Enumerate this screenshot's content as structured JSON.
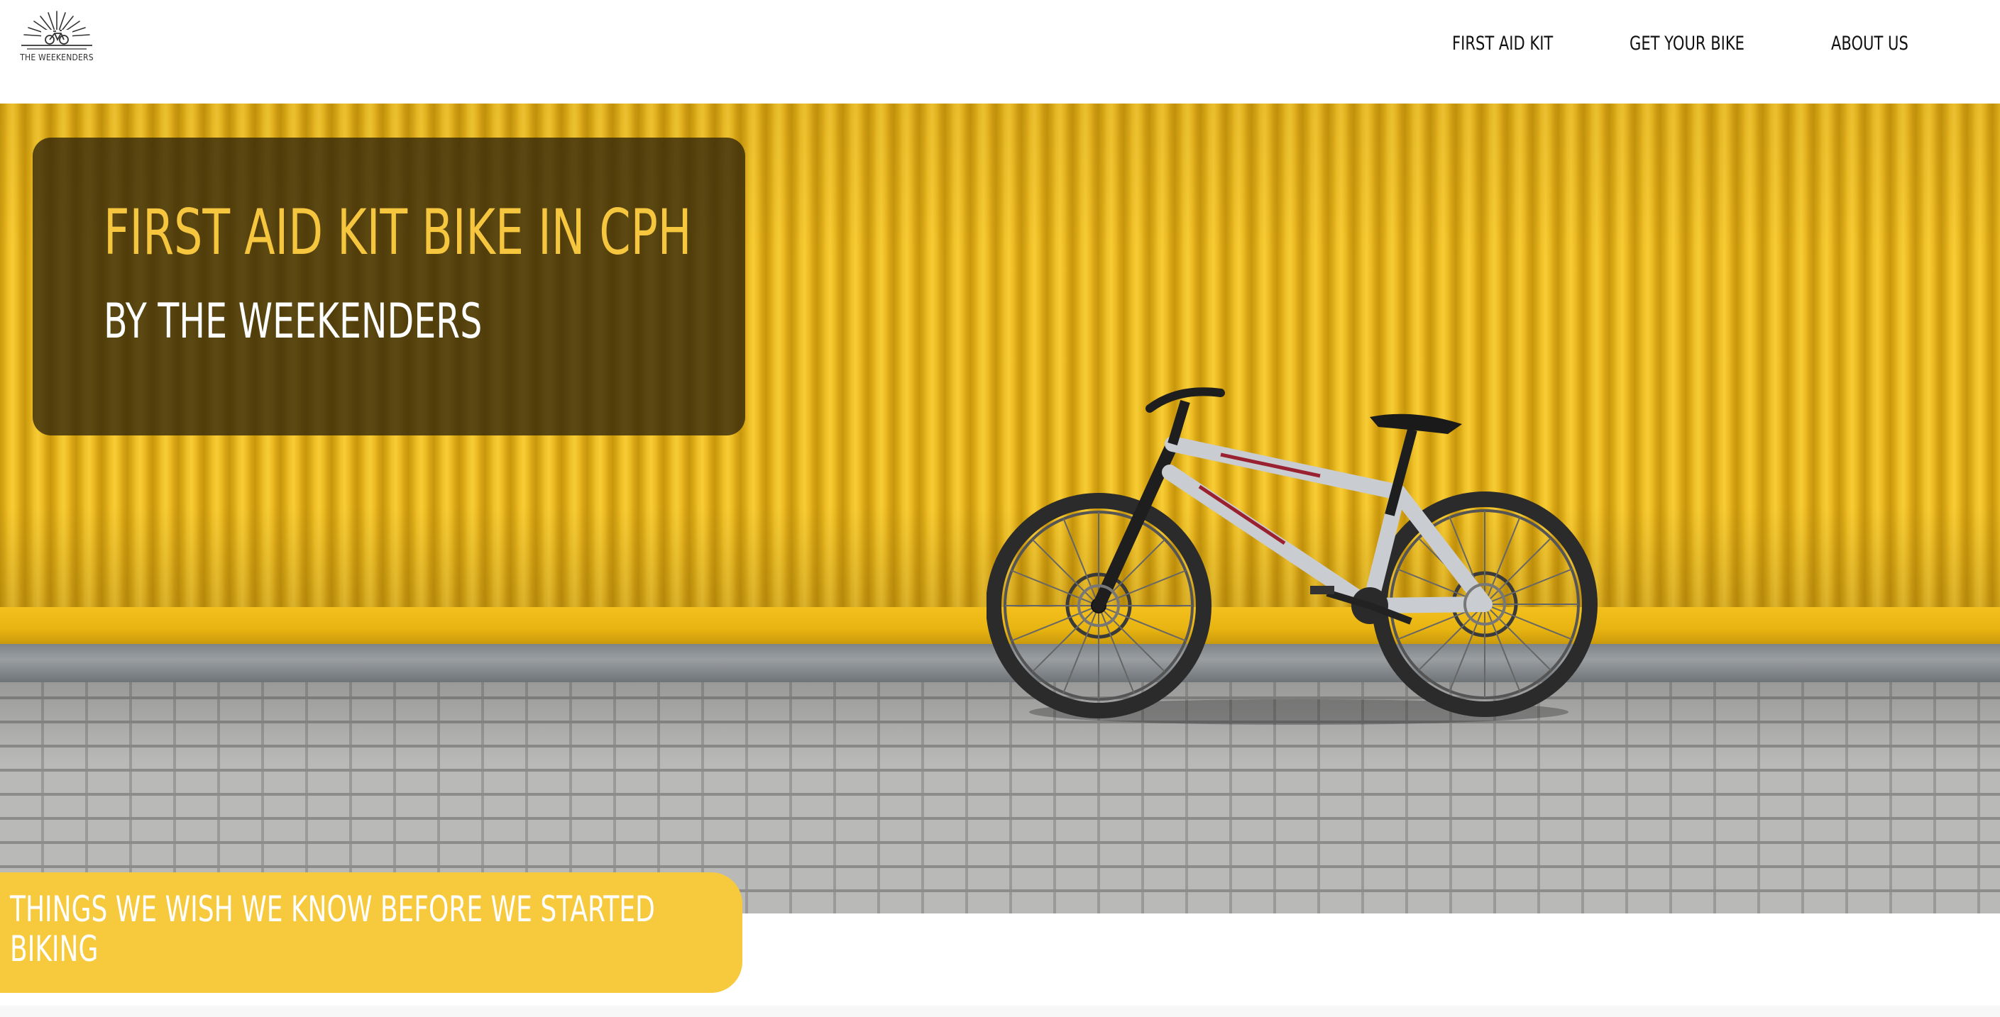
{
  "header": {
    "logo_text": "THE WEEKENDERS",
    "nav": [
      {
        "label": "FIRST AID KIT"
      },
      {
        "label": "GET YOUR BIKE"
      },
      {
        "label": "ABOUT US"
      }
    ]
  },
  "hero": {
    "title": "FIRST AID KIT BIKE IN CPH",
    "subtitle": "BY THE WEEKENDERS"
  },
  "banner": {
    "text": "THINGS WE WISH WE KNOW BEFORE WE STARTED BIKING"
  },
  "colors": {
    "accent_yellow": "#f7c93d",
    "title_yellow": "#f6c63f",
    "card_overlay": "#30240a"
  }
}
